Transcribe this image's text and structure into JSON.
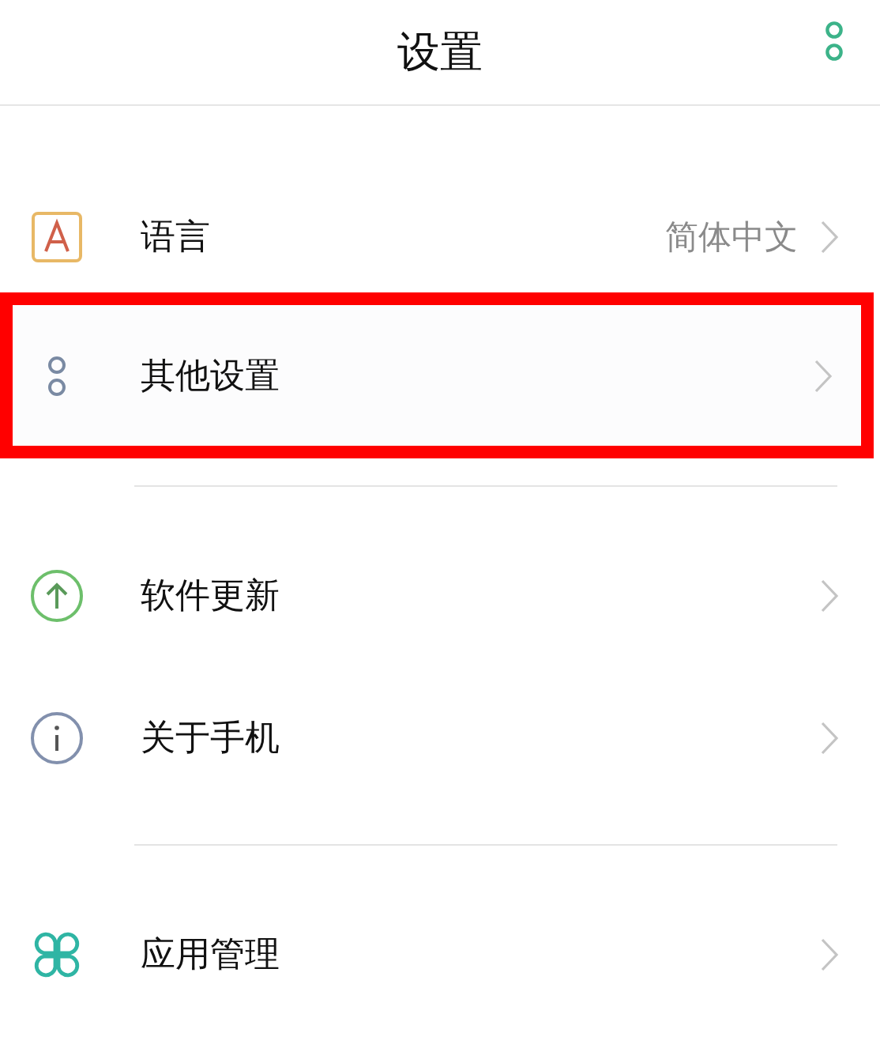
{
  "header": {
    "title": "设置"
  },
  "groups": [
    {
      "items": [
        {
          "label": "语言",
          "value": "简体中文",
          "selected": false
        },
        {
          "label": "其他设置",
          "selected": true
        }
      ]
    },
    {
      "items": [
        {
          "label": "软件更新",
          "selected": false
        },
        {
          "label": "关于手机",
          "selected": false
        }
      ]
    },
    {
      "items": [
        {
          "label": "应用管理",
          "selected": false
        }
      ]
    }
  ]
}
